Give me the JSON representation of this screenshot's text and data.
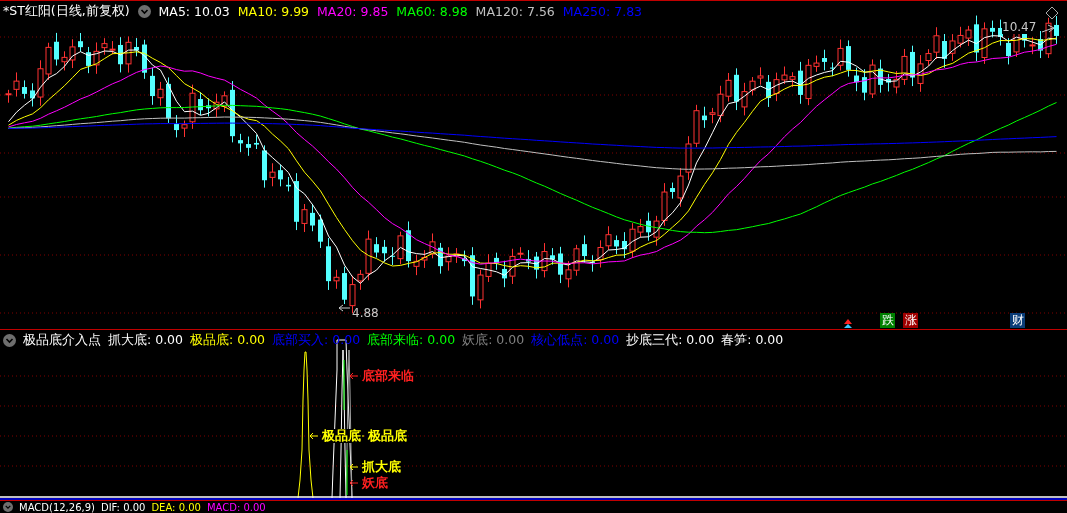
{
  "main": {
    "title": "*ST红阳(日线,前复权)",
    "ma": [
      {
        "label": "MA5:",
        "value": "10.03",
        "color": "#ffffff"
      },
      {
        "label": "MA10:",
        "value": "9.99",
        "color": "#ffff00"
      },
      {
        "label": "MA20:",
        "value": "9.85",
        "color": "#ff00ff"
      },
      {
        "label": "MA60:",
        "value": "8.98",
        "color": "#00ff00"
      },
      {
        "label": "MA120:",
        "value": "7.56",
        "color": "#c0c0c0"
      },
      {
        "label": "MA250:",
        "value": "7.83",
        "color": "#0000ff"
      }
    ],
    "high_label": "10.47",
    "low_label": "4.88",
    "badges": [
      {
        "text": "跌",
        "color": "#008000"
      },
      {
        "text": "涨",
        "color": "#a00000"
      },
      {
        "text": "财",
        "color": "#0a3c78"
      }
    ]
  },
  "indicator": {
    "title": "极品底介入点",
    "values": [
      {
        "label": "抓大底:",
        "value": "0.00",
        "color": "#ffffff"
      },
      {
        "label": "极品底:",
        "value": "0.00",
        "color": "#ffff00"
      },
      {
        "label": "底部买入:",
        "value": "0.00",
        "color": "#0000ff"
      },
      {
        "label": "底部来临:",
        "value": "0.00",
        "color": "#00ff00"
      },
      {
        "label": "妖底:",
        "value": "0.00",
        "color": "#808080"
      },
      {
        "label": "核心低点:",
        "value": "0.00",
        "color": "#0000ff"
      },
      {
        "label": "抄底三代:",
        "value": "0.00",
        "color": "#ffffff"
      },
      {
        "label": "春笋:",
        "value": "0.00",
        "color": "#ffffff"
      }
    ],
    "annotations": [
      {
        "text": "底部来临",
        "color": "#ff2020"
      },
      {
        "text": "极品底",
        "color": "#ffff00"
      },
      {
        "text": "极品底",
        "color": "#ffff00"
      },
      {
        "text": "抓大底",
        "color": "#ffff00"
      },
      {
        "text": "妖底",
        "color": "#ff2020"
      }
    ]
  },
  "macd": {
    "title": "MACD(12,26,9)",
    "values": [
      {
        "label": "DIF:",
        "value": "0.00",
        "color": "#ffffff"
      },
      {
        "label": "DEA:",
        "value": "0.00",
        "color": "#ffff00"
      },
      {
        "label": "MACD:",
        "value": "0.00",
        "color": "#ff00ff"
      }
    ]
  }
}
